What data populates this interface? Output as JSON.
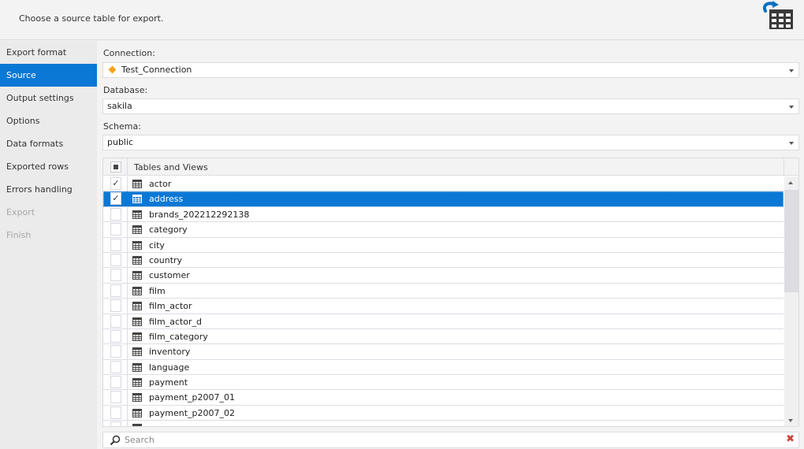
{
  "header": {
    "description": "Choose a source table for export.",
    "icon": "export-table-icon"
  },
  "sidebar": {
    "items": [
      {
        "label": "Export format",
        "state": "normal"
      },
      {
        "label": "Source",
        "state": "active"
      },
      {
        "label": "Output settings",
        "state": "normal"
      },
      {
        "label": "Options",
        "state": "normal"
      },
      {
        "label": "Data formats",
        "state": "normal"
      },
      {
        "label": "Exported rows",
        "state": "normal"
      },
      {
        "label": "Errors handling",
        "state": "normal"
      },
      {
        "label": "Export",
        "state": "disabled"
      },
      {
        "label": "Finish",
        "state": "disabled"
      }
    ]
  },
  "form": {
    "connection": {
      "label": "Connection:",
      "value": "Test_Connection",
      "icon": "connection-diamond-icon",
      "color": "#f7a21b"
    },
    "database": {
      "label": "Database:",
      "value": "sakila"
    },
    "schema": {
      "label": "Schema:",
      "value": "public"
    }
  },
  "grid": {
    "header": "Tables and Views",
    "header_check_state": "partial",
    "rows": [
      {
        "name": "actor",
        "checked": true,
        "selected": false
      },
      {
        "name": "address",
        "checked": true,
        "selected": true
      },
      {
        "name": "brands_202212292138",
        "checked": false,
        "selected": false
      },
      {
        "name": "category",
        "checked": false,
        "selected": false
      },
      {
        "name": "city",
        "checked": false,
        "selected": false
      },
      {
        "name": "country",
        "checked": false,
        "selected": false
      },
      {
        "name": "customer",
        "checked": false,
        "selected": false
      },
      {
        "name": "film",
        "checked": false,
        "selected": false
      },
      {
        "name": "film_actor",
        "checked": false,
        "selected": false
      },
      {
        "name": "film_actor_d",
        "checked": false,
        "selected": false
      },
      {
        "name": "film_category",
        "checked": false,
        "selected": false
      },
      {
        "name": "inventory",
        "checked": false,
        "selected": false
      },
      {
        "name": "language",
        "checked": false,
        "selected": false
      },
      {
        "name": "payment",
        "checked": false,
        "selected": false
      },
      {
        "name": "payment_p2007_01",
        "checked": false,
        "selected": false
      },
      {
        "name": "payment_p2007_02",
        "checked": false,
        "selected": false
      },
      {
        "name": "",
        "checked": false,
        "selected": false
      }
    ],
    "check_mark": "✓"
  },
  "search": {
    "placeholder": "Search",
    "clear_glyph": "✖"
  },
  "colors": {
    "accent": "#0a78d4",
    "clear": "#d0413a"
  }
}
